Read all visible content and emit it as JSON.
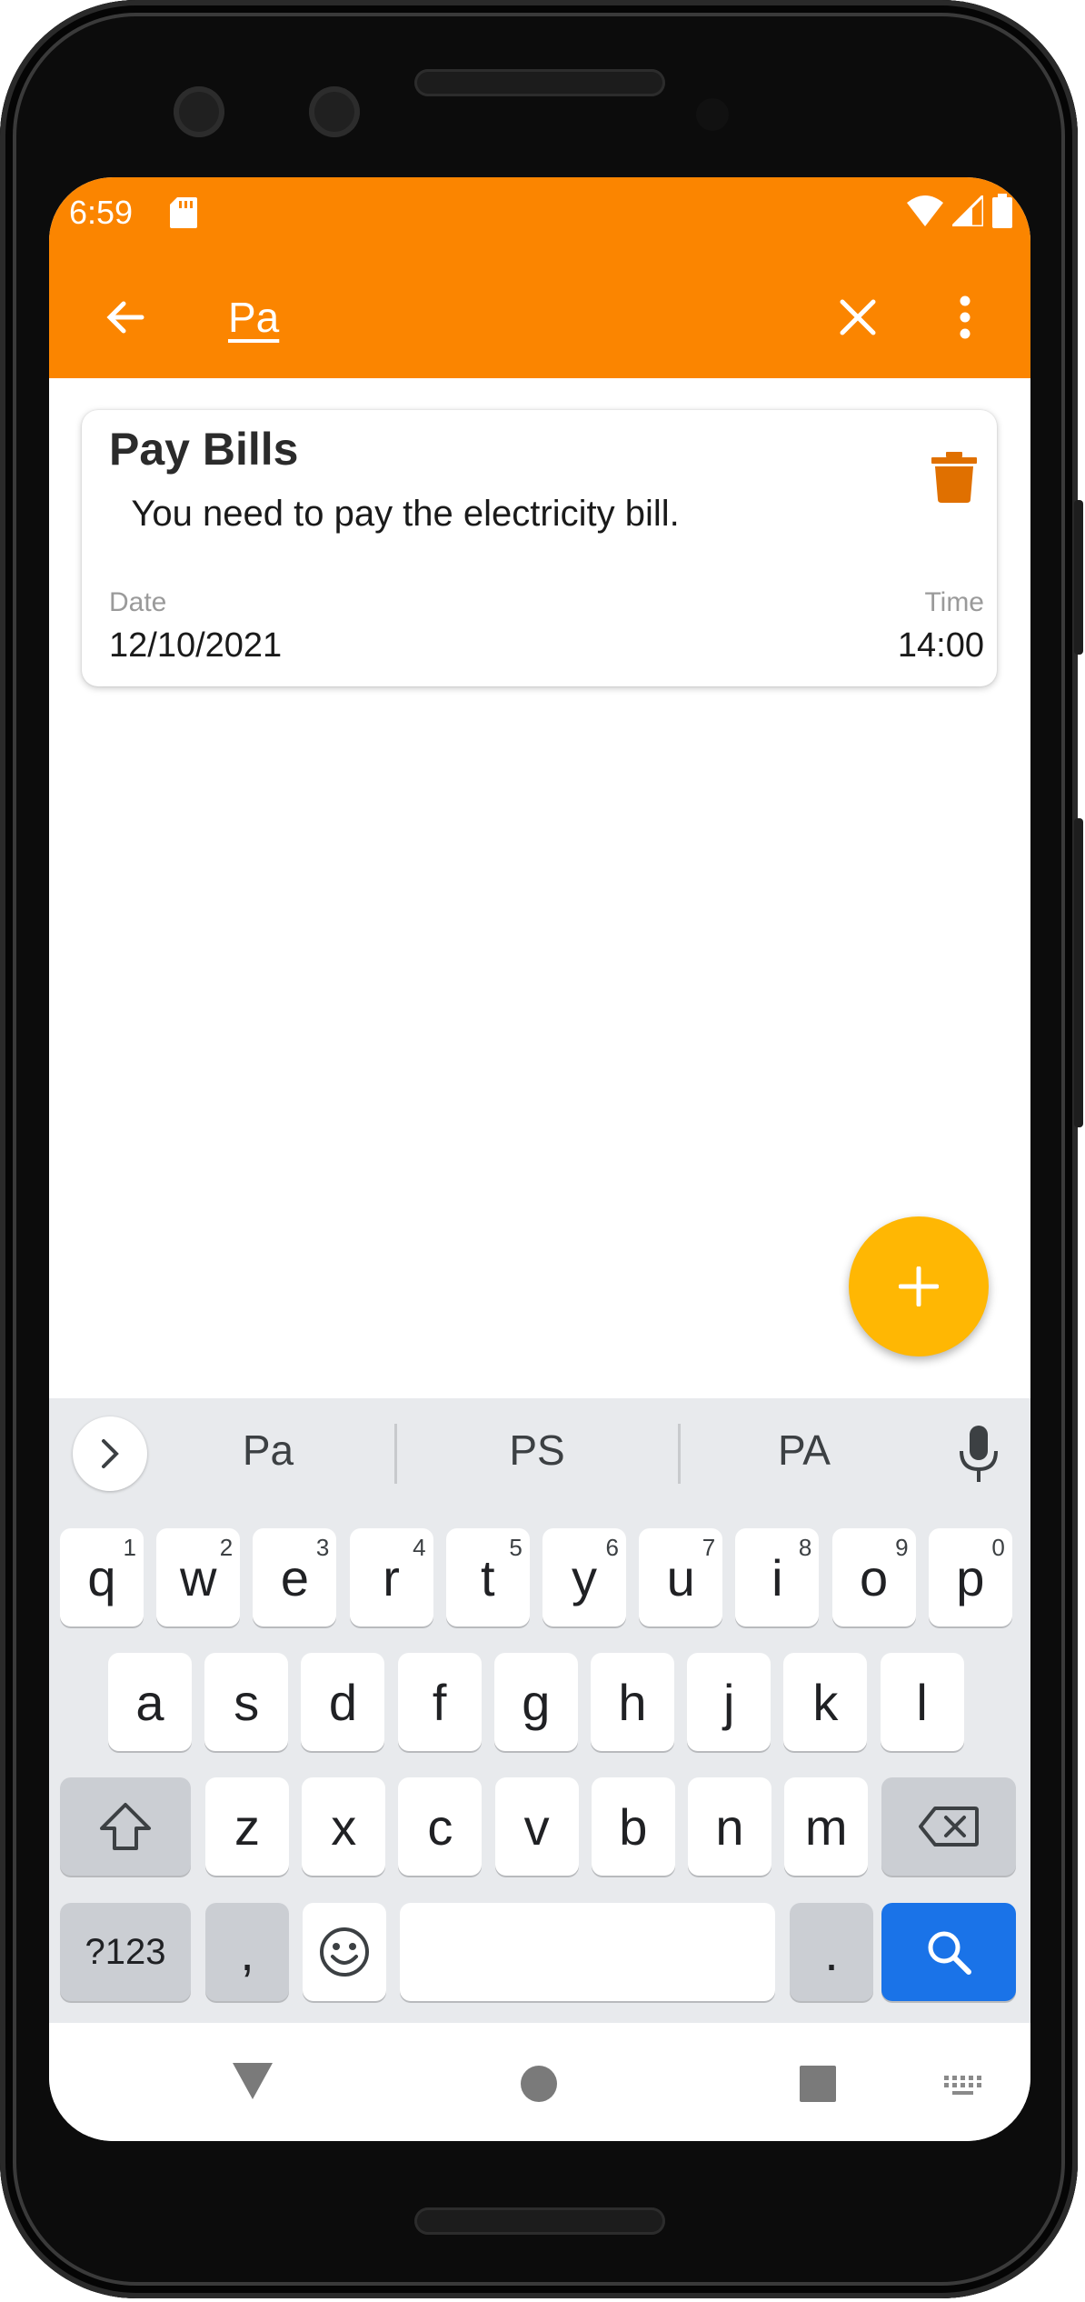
{
  "status_bar": {
    "time": "6:59"
  },
  "app_bar": {
    "search_query": "Pa"
  },
  "results": [
    {
      "title": "Pay Bills",
      "description": " You need to pay the electricity bill.",
      "date_label": "Date",
      "date": "12/10/2021",
      "time_label": "Time",
      "time": "14:00"
    }
  ],
  "keyboard": {
    "suggestions": [
      "Pa",
      "PS",
      "PA"
    ],
    "row1": [
      {
        "key": "q",
        "hint": "1"
      },
      {
        "key": "w",
        "hint": "2"
      },
      {
        "key": "e",
        "hint": "3"
      },
      {
        "key": "r",
        "hint": "4"
      },
      {
        "key": "t",
        "hint": "5"
      },
      {
        "key": "y",
        "hint": "6"
      },
      {
        "key": "u",
        "hint": "7"
      },
      {
        "key": "i",
        "hint": "8"
      },
      {
        "key": "o",
        "hint": "9"
      },
      {
        "key": "p",
        "hint": "0"
      }
    ],
    "row2": [
      "a",
      "s",
      "d",
      "f",
      "g",
      "h",
      "j",
      "k",
      "l"
    ],
    "row3": [
      "z",
      "x",
      "c",
      "v",
      "b",
      "n",
      "m"
    ],
    "symbols_key": "?123",
    "comma_key": ",",
    "period_key": "."
  },
  "colors": {
    "accent": "#fb8500",
    "fab": "#ffb703",
    "trash": "#e07000",
    "search_key": "#1a73e8"
  }
}
